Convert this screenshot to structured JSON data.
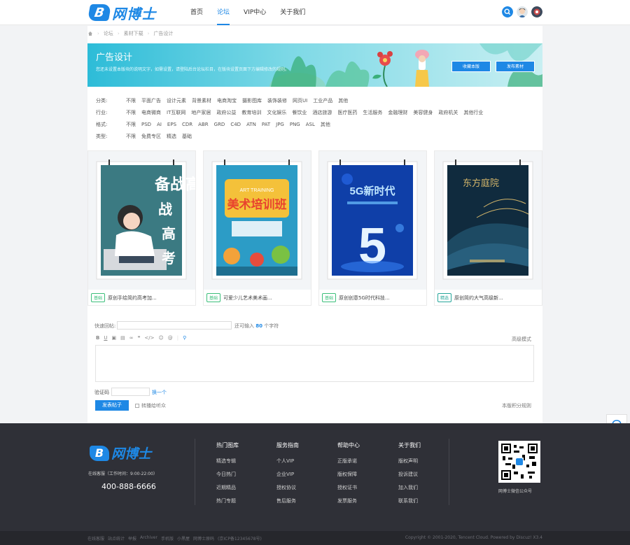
{
  "header": {
    "logo_badge": "B",
    "logo_text": "网博士",
    "nav": [
      {
        "label": "首页"
      },
      {
        "label": "论坛"
      },
      {
        "label": "VIP中心"
      },
      {
        "label": "关于我们"
      }
    ],
    "accent": "#1e88e5"
  },
  "breadcrumb": [
    "论坛",
    "素材下载",
    "广告设计"
  ],
  "banner": {
    "title": "广告设计",
    "desc": "您还未设置本版块的说明文字，如需设置，请登陆后台论坛栏目，在版块设置页面下方编辑修改的规则。",
    "btn_collect": "收藏本版",
    "btn_post": "发布素材"
  },
  "filters": [
    {
      "label": "分类:",
      "options": [
        "不限",
        "平面广告",
        "设计元素",
        "背景素材",
        "电商淘宝",
        "摄影图库",
        "装饰装修",
        "网页UI",
        "工业产品",
        "其他"
      ]
    },
    {
      "label": "行业:",
      "options": [
        "不限",
        "电商微商",
        "IT互联网",
        "地产家居",
        "政府公益",
        "教育培训",
        "文化娱乐",
        "餐饮业",
        "酒店旅游",
        "医疗医药",
        "生活服务",
        "金融理财",
        "美容健身",
        "政府机关",
        "其他行业"
      ]
    },
    {
      "label": "格式:",
      "options": [
        "不限",
        "PSD",
        "AI",
        "EPS",
        "CDR",
        "ABR",
        "GRD",
        "C4D",
        "ATN",
        "PAT",
        "JPG",
        "PNG",
        "ASL",
        "其他"
      ]
    },
    {
      "label": "类型:",
      "options": [
        "不限",
        "免费专区",
        "精选",
        "基础"
      ]
    }
  ],
  "cards": [
    {
      "tag": "基础",
      "title": "原创手绘简约高考加...",
      "poster_text": "备战高考"
    },
    {
      "tag": "基础",
      "title": "可爱少儿艺术美术画...",
      "poster_text": "美术培训班",
      "poster_sub": "ART TRAINING"
    },
    {
      "tag": "基础",
      "title": "原创创意5G时代科技...",
      "poster_text": "5G新时代",
      "poster_big": "5"
    },
    {
      "tag": "精选",
      "title": "原创简约大气高级新...",
      "poster_text": "东方庭院"
    }
  ],
  "reply": {
    "quick_label": "快速回帖:",
    "remaining_prefix": "还可输入",
    "remaining_count": "80",
    "remaining_suffix": "个字符",
    "advanced_mode": "高级模式",
    "captcha_label": "验证码",
    "captcha_refresh": "换一个",
    "submit": "发表帖子",
    "broadcast": "转播给听众",
    "rules": "本版积分规则"
  },
  "footer": {
    "hours": "在线客服（工作时间：9:00-22:00）",
    "phone": "400-888-6666",
    "columns": [
      {
        "title": "热门图库",
        "links": [
          "精选专辑",
          "今日热门",
          "近期精品",
          "热门专题"
        ]
      },
      {
        "title": "服务指南",
        "links": [
          "个人VIP",
          "企业VIP",
          "授权协议",
          "售后服务"
        ]
      },
      {
        "title": "帮助中心",
        "links": [
          "正版承诺",
          "版权保障",
          "授权证书",
          "发票服务"
        ]
      },
      {
        "title": "关于我们",
        "links": [
          "版权声明",
          "投诉建议",
          "加入我们",
          "联系我们"
        ]
      }
    ],
    "qr_label": "网博士微信公众号"
  },
  "bottom": {
    "links": [
      "在线客服",
      "站点统计",
      "举报",
      "Archiver",
      "手机版",
      "小黑屋",
      "网博士原码",
      "(京ICP备12345678号)"
    ],
    "copyright": "Copyright © 2001-2020, Tencent Cloud. Powered by Discuz! X3.4"
  }
}
